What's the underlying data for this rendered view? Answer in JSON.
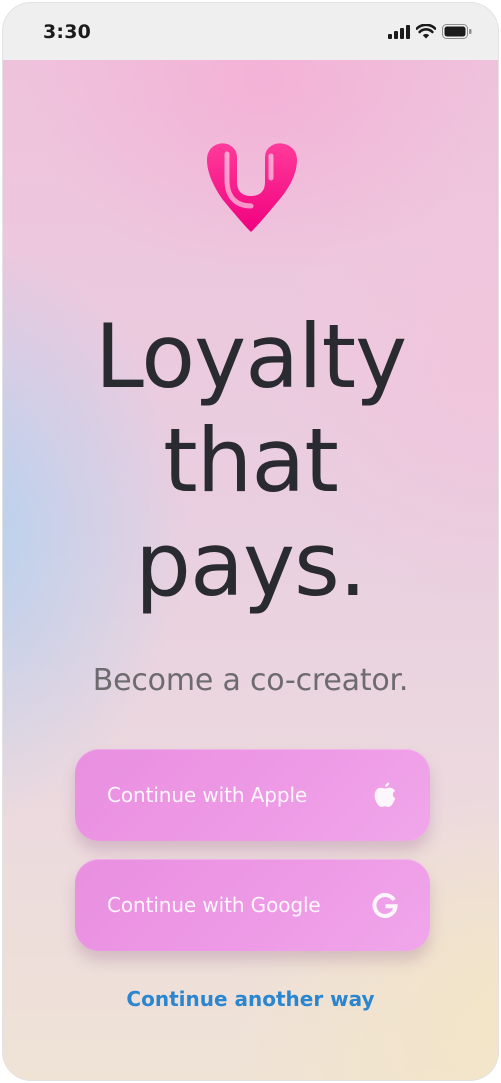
{
  "status_bar": {
    "time": "3:30",
    "icons": [
      "cellular-signal-icon",
      "wifi-icon",
      "battery-icon"
    ]
  },
  "brand": {
    "logo": "brand-logo-icon",
    "logo_colors": [
      "#ff3b9a",
      "#f0007f"
    ]
  },
  "hero": {
    "headline_lines": [
      "Loyalty",
      "that",
      "pays."
    ],
    "subline": "Become a co-creator."
  },
  "auth": {
    "apple_label": "Continue with Apple",
    "apple_icon": "apple-icon",
    "google_label": "Continue with Google",
    "google_icon": "google-icon",
    "other_label": "Continue another way"
  },
  "colors": {
    "button": "#ee9ae6",
    "link": "#2a86cf",
    "headline": "#2a2b30"
  }
}
